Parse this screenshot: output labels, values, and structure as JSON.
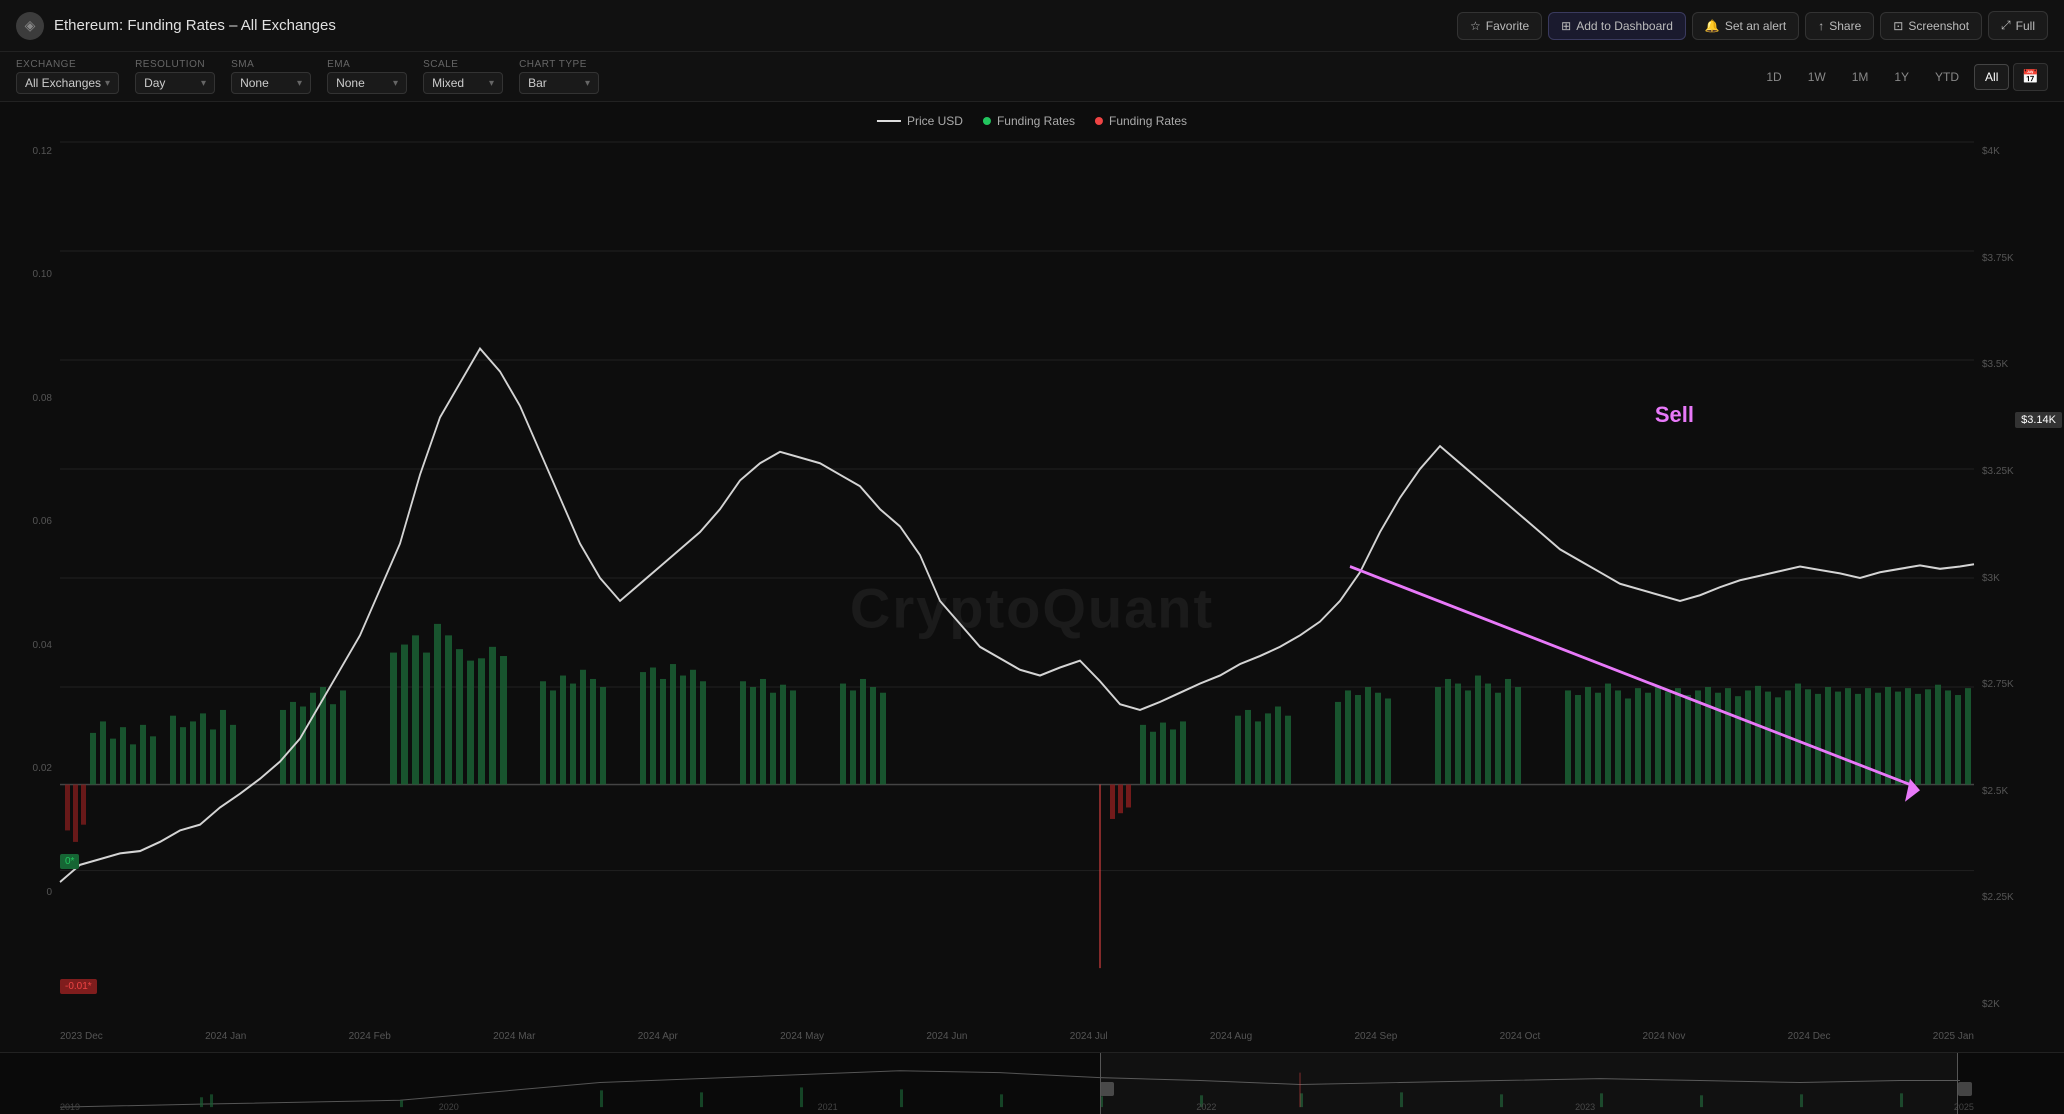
{
  "header": {
    "logo_symbol": "◈",
    "title": "Ethereum: Funding Rates – All Exchanges",
    "favorite_label": "Favorite",
    "add_dashboard_label": "Add to Dashboard",
    "alert_label": "Set an alert",
    "share_label": "Share",
    "screenshot_label": "Screenshot",
    "full_label": "Full"
  },
  "toolbar": {
    "exchange_label": "Exchange",
    "exchange_value": "All Exchanges",
    "resolution_label": "Resolution",
    "resolution_value": "Day",
    "sma_label": "SMA",
    "sma_value": "None",
    "ema_label": "EMA",
    "ema_value": "None",
    "scale_label": "Scale",
    "scale_value": "Mixed",
    "chart_type_label": "Chart Type",
    "chart_type_value": "Bar",
    "time_buttons": [
      "1D",
      "1W",
      "1M",
      "1Y",
      "YTD",
      "All"
    ],
    "active_time": "All"
  },
  "chart": {
    "watermark": "CryptoQuant",
    "legend_price": "Price USD",
    "legend_funding_green": "Funding Rates",
    "legend_funding_red": "Funding Rates",
    "y_left_labels": [
      "0.12",
      "0.10",
      "0.08",
      "0.06",
      "0.04",
      "0.02",
      "0",
      "-0.01"
    ],
    "y_right_labels": [
      "$4K",
      "$3.75K",
      "$3.5K",
      "$3.25K",
      "$3K",
      "$2.75K",
      "$2.5K",
      "$2.25K",
      "$2K"
    ],
    "price_badge": "$3.14K",
    "x_labels": [
      "2023 Dec",
      "2024 Jan",
      "2024 Feb",
      "2024 Mar",
      "2024 Apr",
      "2024 May",
      "2024 Jun",
      "2024 Jul",
      "2024 Aug",
      "2024 Sep",
      "2024 Oct",
      "2024 Nov",
      "2024 Dec",
      "2025 Jan"
    ],
    "green_badge": "0*",
    "red_badge": "-0.01*",
    "sell_label": "Sell",
    "mini_x_labels": [
      "2019",
      "2020",
      "2021",
      "2022",
      "2023",
      "2025"
    ]
  },
  "colors": {
    "background": "#0d0d0d",
    "accent_green": "#22c55e",
    "accent_red": "#ef4444",
    "price_line": "#d4d4d4",
    "bar_green": "#166534",
    "bar_green_bright": "#22c55e",
    "sell_arrow": "#e879f9",
    "grid": "#1a1a1a"
  }
}
